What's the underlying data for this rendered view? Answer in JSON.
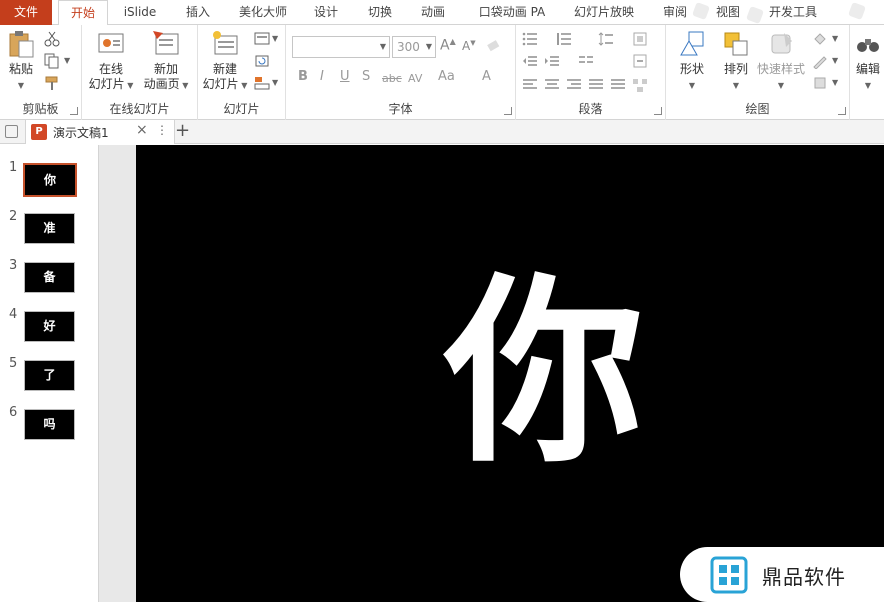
{
  "tabs": {
    "file": "文件",
    "home": "开始",
    "islide": "iSlide",
    "insert": "插入",
    "beautify": "美化大师",
    "design": "设计",
    "transitions": "切换",
    "animations": "动画",
    "pocket": "口袋动画 PA",
    "slideshow": "幻灯片放映",
    "review": "审阅",
    "view": "视图",
    "developer": "开发工具"
  },
  "ribbon": {
    "clipboard": {
      "paste": "粘贴",
      "label": "剪贴板"
    },
    "online_slides": {
      "online_line1": "在线",
      "online_line2": "幻灯片",
      "new_anim_line1": "新加",
      "new_anim_line2": "动画页",
      "label": "在线幻灯片"
    },
    "slides": {
      "new_line1": "新建",
      "new_line2": "幻灯片",
      "label": "幻灯片"
    },
    "font": {
      "size": "300",
      "bold": "B",
      "italic": "I",
      "underline": "U",
      "shadow": "S",
      "strike": "abc",
      "spacing": "AV",
      "case": "Aa",
      "label": "字体"
    },
    "paragraph": {
      "label": "段落"
    },
    "drawing": {
      "shapes": "形状",
      "arrange": "排列",
      "quick_styles": "快速样式",
      "label": "绘图"
    },
    "editing": {
      "label": "编辑"
    }
  },
  "document": {
    "tab_title": "演示文稿1",
    "close": "×",
    "more": "⋮",
    "add": "+"
  },
  "thumbnails": [
    {
      "num": "1",
      "char": "你"
    },
    {
      "num": "2",
      "char": "准"
    },
    {
      "num": "3",
      "char": "备"
    },
    {
      "num": "4",
      "char": "好"
    },
    {
      "num": "5",
      "char": "了"
    },
    {
      "num": "6",
      "char": "吗"
    }
  ],
  "slide": {
    "char": "你"
  },
  "watermark": {
    "text": "鼎品软件"
  },
  "colors": {
    "accent": "#c43e1c",
    "slide_bg": "#000000",
    "slide_text": "#ffffff"
  }
}
